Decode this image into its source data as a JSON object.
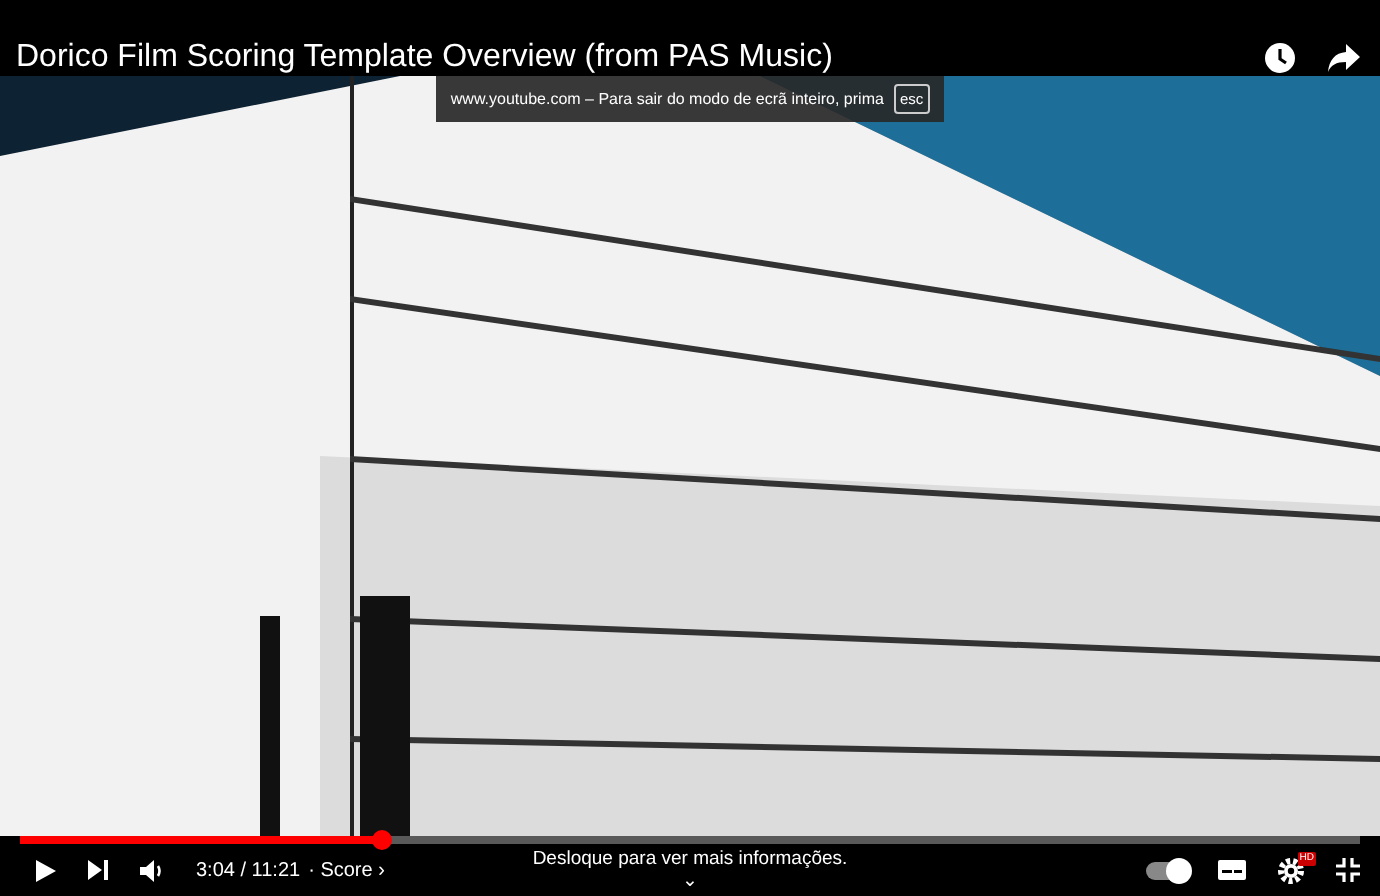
{
  "title": "Dorico Film Scoring Template Overview (from PAS Music)",
  "fullscreen_notice": {
    "text": "www.youtube.com – Para sair do modo de ecrã inteiro, prima",
    "key": "esc"
  },
  "progress": {
    "level": 0.27
  },
  "player": {
    "time": "3:04 / 11:21",
    "chapter": "· Score ›",
    "hint": "Desloque para ver mais informações.",
    "hint_arrow": "⌄",
    "autoplay": true,
    "quality_badge": "HD"
  }
}
